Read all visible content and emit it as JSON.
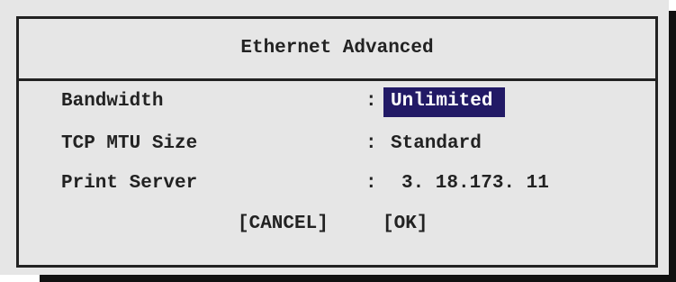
{
  "dialog": {
    "title": "Ethernet Advanced",
    "rows": [
      {
        "label": "Bandwidth",
        "separator": ":",
        "value": "Unlimited",
        "selected": true
      },
      {
        "label": "TCP MTU Size",
        "separator": ":",
        "value": "Standard"
      },
      {
        "label": "Print Server",
        "separator": ":",
        "value": "3. 18.173. 11"
      }
    ],
    "buttons": {
      "cancel": "[CANCEL]",
      "ok": "[OK]"
    }
  },
  "colors": {
    "background": "#e6e6e6",
    "border": "#222222",
    "selection": "#221a66",
    "selection_text": "#ffffff"
  }
}
